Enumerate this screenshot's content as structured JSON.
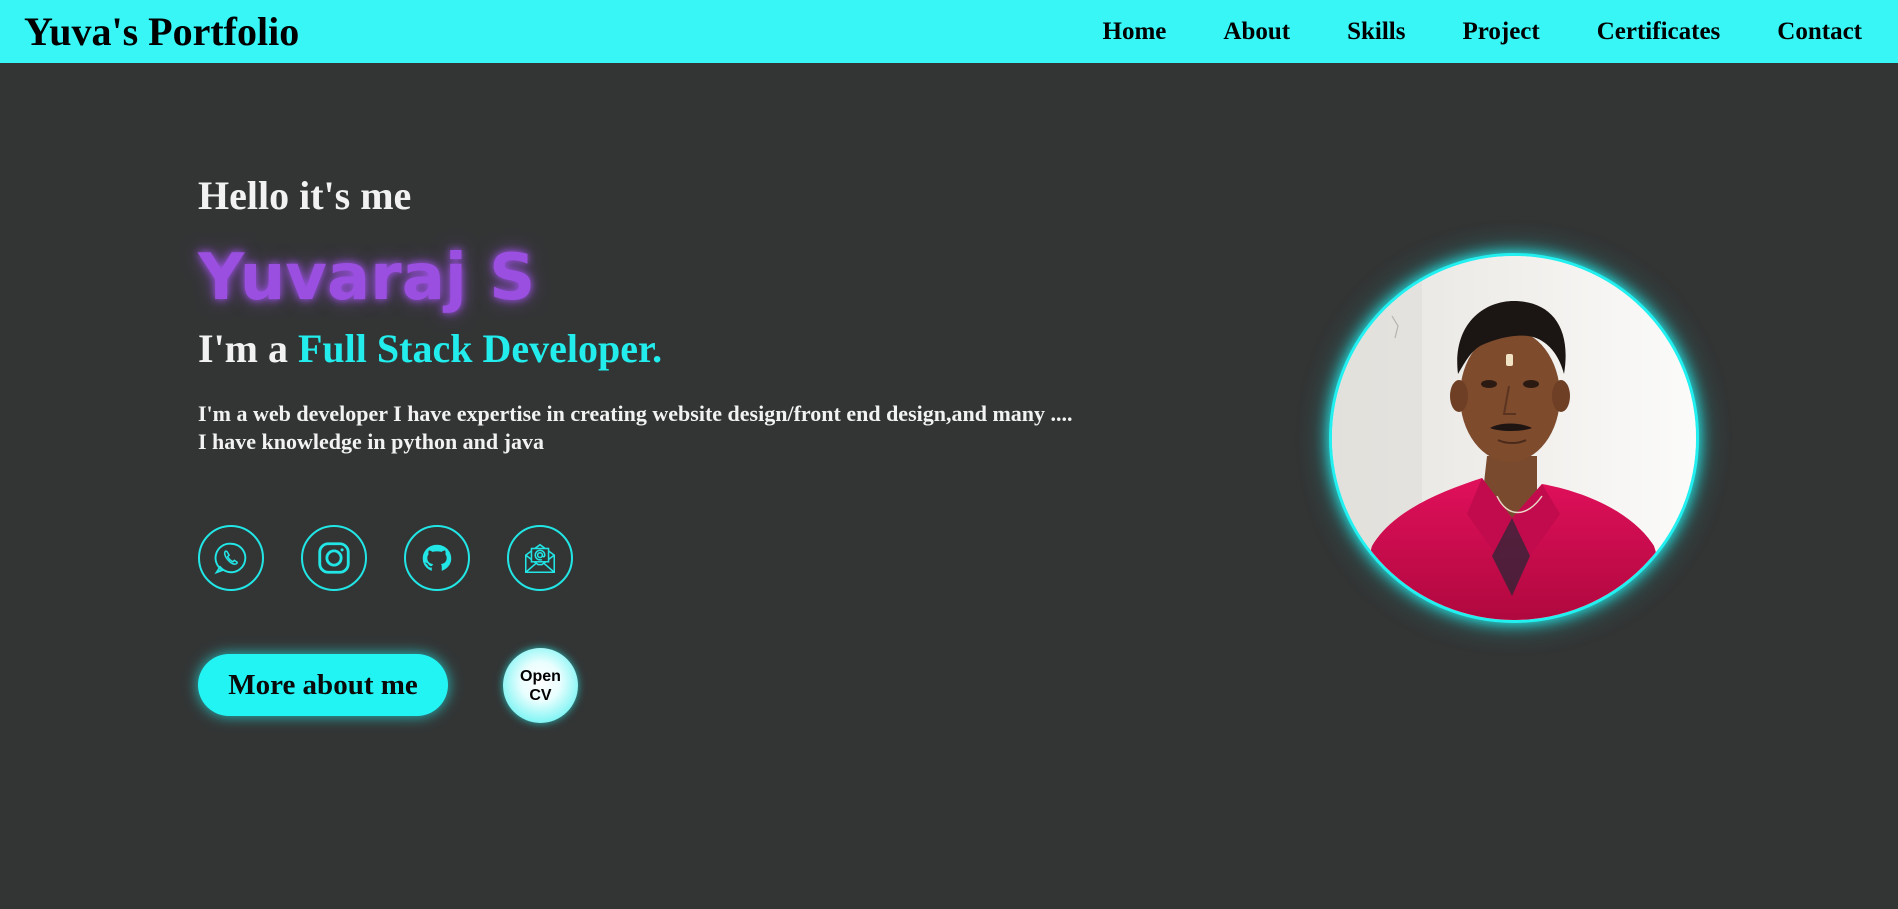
{
  "brand": {
    "title": "Yuva's Portfolio"
  },
  "nav": {
    "items": [
      {
        "label": "Home"
      },
      {
        "label": "About"
      },
      {
        "label": "Skills"
      },
      {
        "label": "Project"
      },
      {
        "label": "Certificates"
      },
      {
        "label": "Contact"
      }
    ]
  },
  "hero": {
    "greeting": "Hello it's me",
    "name": "Yuvaraj S",
    "role_prefix": "I'm a ",
    "role_highlight": "Full Stack Developer.",
    "description_line1": "I'm a web developer I have expertise in creating website design/front end design,and many ....",
    "description_line2": "I have knowledge in python and java"
  },
  "socials": [
    {
      "icon": "whatsapp-icon"
    },
    {
      "icon": "instagram-icon"
    },
    {
      "icon": "github-icon"
    },
    {
      "icon": "email-icon"
    }
  ],
  "actions": {
    "more_label": "More about me",
    "cv_line1": "Open",
    "cv_line2": "CV"
  },
  "profile_photo": {
    "icon": "profile-photo"
  },
  "colors": {
    "navbar": "#38f6f6",
    "background": "#333535",
    "accent": "#22ecec",
    "name": "#9b4fe0"
  }
}
